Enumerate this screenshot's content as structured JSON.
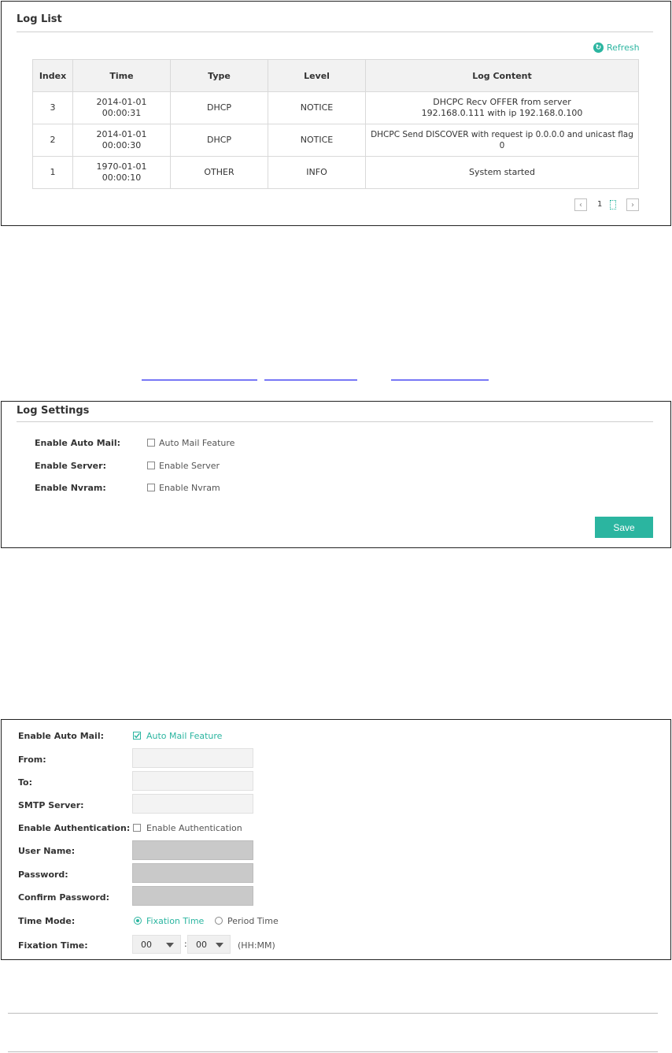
{
  "log_list": {
    "title": "Log List",
    "refresh_label": "Refresh",
    "columns": [
      "Index",
      "Time",
      "Type",
      "Level",
      "Log Content"
    ],
    "rows": [
      {
        "index": "3",
        "time": "2014-01-01 00:00:31",
        "type": "DHCP",
        "level": "NOTICE",
        "content": "DHCPC Recv OFFER from server 192.168.0.111 with ip 192.168.0.100"
      },
      {
        "index": "2",
        "time": "2014-01-01 00:00:30",
        "type": "DHCP",
        "level": "NOTICE",
        "content": "DHCPC Send DISCOVER with request ip 0.0.0.0 and unicast flag 0"
      },
      {
        "index": "1",
        "time": "1970-01-01 00:00:10",
        "type": "OTHER",
        "level": "INFO",
        "content": "System started"
      }
    ],
    "pager": {
      "current_page": "1",
      "prev_icon": "chevron-left-icon",
      "next_icon": "chevron-right-icon"
    }
  },
  "log_settings": {
    "title": "Log Settings",
    "fields": [
      {
        "label": "Enable Auto Mail:",
        "checkbox_label": "Auto Mail Feature",
        "checked": false
      },
      {
        "label": "Enable Server:",
        "checkbox_label": "Enable Server",
        "checked": false
      },
      {
        "label": "Enable Nvram:",
        "checkbox_label": "Enable Nvram",
        "checked": false
      }
    ],
    "save_label": "Save"
  },
  "mail_settings": {
    "auto_mail": {
      "label": "Enable Auto Mail:",
      "checkbox_label": "Auto Mail Feature",
      "checked": true
    },
    "from_label": "From:",
    "to_label": "To:",
    "smtp_label": "SMTP Server:",
    "auth": {
      "label": "Enable Authentication:",
      "checkbox_label": "Enable Authentication",
      "checked": false
    },
    "username_label": "User Name:",
    "password_label": "Password:",
    "confirm_label": "Confirm Password:",
    "time_mode": {
      "label": "Time Mode:",
      "option_fixation": "Fixation Time",
      "option_period": "Period Time",
      "selected": "Fixation Time"
    },
    "fixation": {
      "label": "Fixation Time:",
      "hour": "00",
      "separator": ":",
      "minute": "00",
      "format_hint": "(HH:MM)"
    }
  },
  "colors": {
    "accent": "#2bb5a0",
    "border": "#222222",
    "disabled_field": "#c9c9c9"
  }
}
